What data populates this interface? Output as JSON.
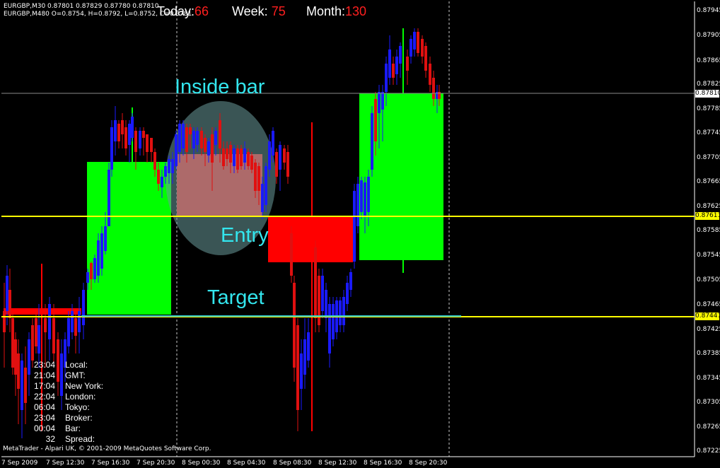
{
  "header": {
    "line1": "EURGBP,M30  0.87801 0.87829 0.87780 0.87810",
    "line2": "EURGBP,M480  O=0.8754, H=0.8792, L=0.8752, C=0.8781"
  },
  "stats": {
    "today_label": "Today:",
    "today_value": "66",
    "week_label": "Week:",
    "week_value": "75",
    "month_label": "Month:",
    "month_value": "130"
  },
  "annotations": {
    "inside_bar": "Inside bar",
    "entry": "Entry",
    "target": "Target"
  },
  "price_axis": {
    "ticks": [
      "0.87945",
      "0.87905",
      "0.87865",
      "0.87825",
      "0.87785",
      "0.87745",
      "0.87705",
      "0.87665",
      "0.87625",
      "0.87585",
      "0.87545",
      "0.87505",
      "0.87465",
      "0.87425",
      "0.87385",
      "0.87345",
      "0.87305",
      "0.87265",
      "0.87225"
    ],
    "current_price": "0.87810",
    "entry_price": "0.87611",
    "target_price": "0.87447"
  },
  "time_axis": {
    "ticks": [
      "7 Sep 2009",
      "7 Sep 12:30",
      "7 Sep 16:30",
      "7 Sep 20:30",
      "8 Sep 00:30",
      "8 Sep 04:30",
      "8 Sep 08:30",
      "8 Sep 12:30",
      "8 Sep 16:30",
      "8 Sep 20:30"
    ]
  },
  "clock": {
    "rows": [
      {
        "time": "23:04",
        "name": "Local:"
      },
      {
        "time": "21:04",
        "name": "GMT:"
      },
      {
        "time": "17:04",
        "name": "New York:"
      },
      {
        "time": "22:04",
        "name": "London:"
      },
      {
        "time": "06:04",
        "name": "Tokyo:"
      },
      {
        "time": "23:04",
        "name": "Broker:"
      },
      {
        "time": "00:04",
        "name": "Bar:"
      },
      {
        "time": "32",
        "name": "Spread:"
      }
    ]
  },
  "footer": "MetaTrader - Alpari UK, © 2001-2009 MetaQuotes Software Corp.",
  "colors": {
    "background": "#000000",
    "bull_box": "#00ff00",
    "bear_box": "#ff0000",
    "candle_bull": "#1a1aff",
    "candle_bear": "#e01010",
    "level_line": "#ffff00",
    "annotation": "#33e6ee",
    "ellipse": "#4a6a6a",
    "inside_box": "#e06060"
  },
  "chart_data": {
    "type": "candlestick",
    "symbol": "EURGBP",
    "timeframe": "M30",
    "overlay_timeframe": "M480",
    "ylim": [
      0.87205,
      0.87965
    ],
    "levels": [
      0.8781,
      0.87611,
      0.87447
    ],
    "m480_bars": [
      {
        "open": 0.8745,
        "close": 0.8744,
        "high": 0.8758,
        "low": 0.8722
      },
      {
        "open": 0.8745,
        "close": 0.877,
        "high": 0.8779,
        "low": 0.8745
      },
      {
        "open": 0.8771,
        "close": 0.8761,
        "high": 0.8775,
        "low": 0.8761
      },
      {
        "open": 0.8761,
        "close": 0.8754,
        "high": 0.8776,
        "low": 0.8726
      },
      {
        "open": 0.8754,
        "close": 0.8781,
        "high": 0.8792,
        "low": 0.8752
      }
    ]
  }
}
